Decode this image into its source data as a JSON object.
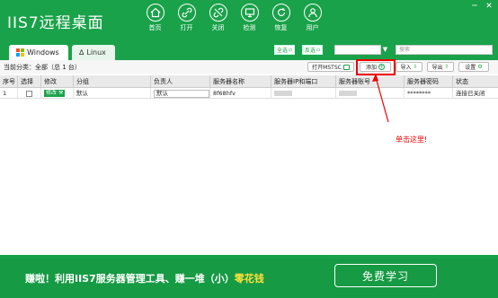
{
  "app": {
    "title": "IIS7远程桌面"
  },
  "nav": [
    {
      "label": "首页",
      "icon": "home-icon"
    },
    {
      "label": "打开",
      "icon": "link-icon"
    },
    {
      "label": "关闭",
      "icon": "unlink-icon"
    },
    {
      "label": "检测",
      "icon": "monitor-icon"
    },
    {
      "label": "恢复",
      "icon": "reload-icon"
    },
    {
      "label": "用户",
      "icon": "user-icon"
    }
  ],
  "window": {
    "minimize": "─",
    "close": "✕"
  },
  "tabs": [
    {
      "label": "Windows"
    },
    {
      "label": "Linux"
    }
  ],
  "filter": {
    "select_all": "全选",
    "invert": "反选",
    "search_placeholder": "搜索",
    "dropdown_arrow": "▼"
  },
  "toolbar": {
    "category_label": "当前分类：全部（总 1 台）",
    "open_mstsc": "打开MSTSC",
    "add": "添加",
    "import": "导入",
    "export": "导出",
    "settings": "设置"
  },
  "table": {
    "columns": [
      "序号",
      "选择",
      "修改",
      "分组",
      "负责人",
      "服务器名称",
      "服务器IP和端口",
      "服务器账号",
      "服务器密码",
      "状态"
    ],
    "rows": [
      {
        "index": "1",
        "edit": "修改",
        "group": "默认",
        "owner": "默认",
        "name": "8f68hfv",
        "password": "********",
        "status": "连接已关闭"
      }
    ]
  },
  "annotation": {
    "text": "单击这里!"
  },
  "banner": {
    "part1": "赚啦！利用IIS7服务器管理工具、赚一堆（小）",
    "highlight": "零花钱",
    "button": "免费学习"
  },
  "colors": {
    "brand": "#1aa24a",
    "annotation": "#e00000",
    "highlight": "#ffe13a"
  }
}
